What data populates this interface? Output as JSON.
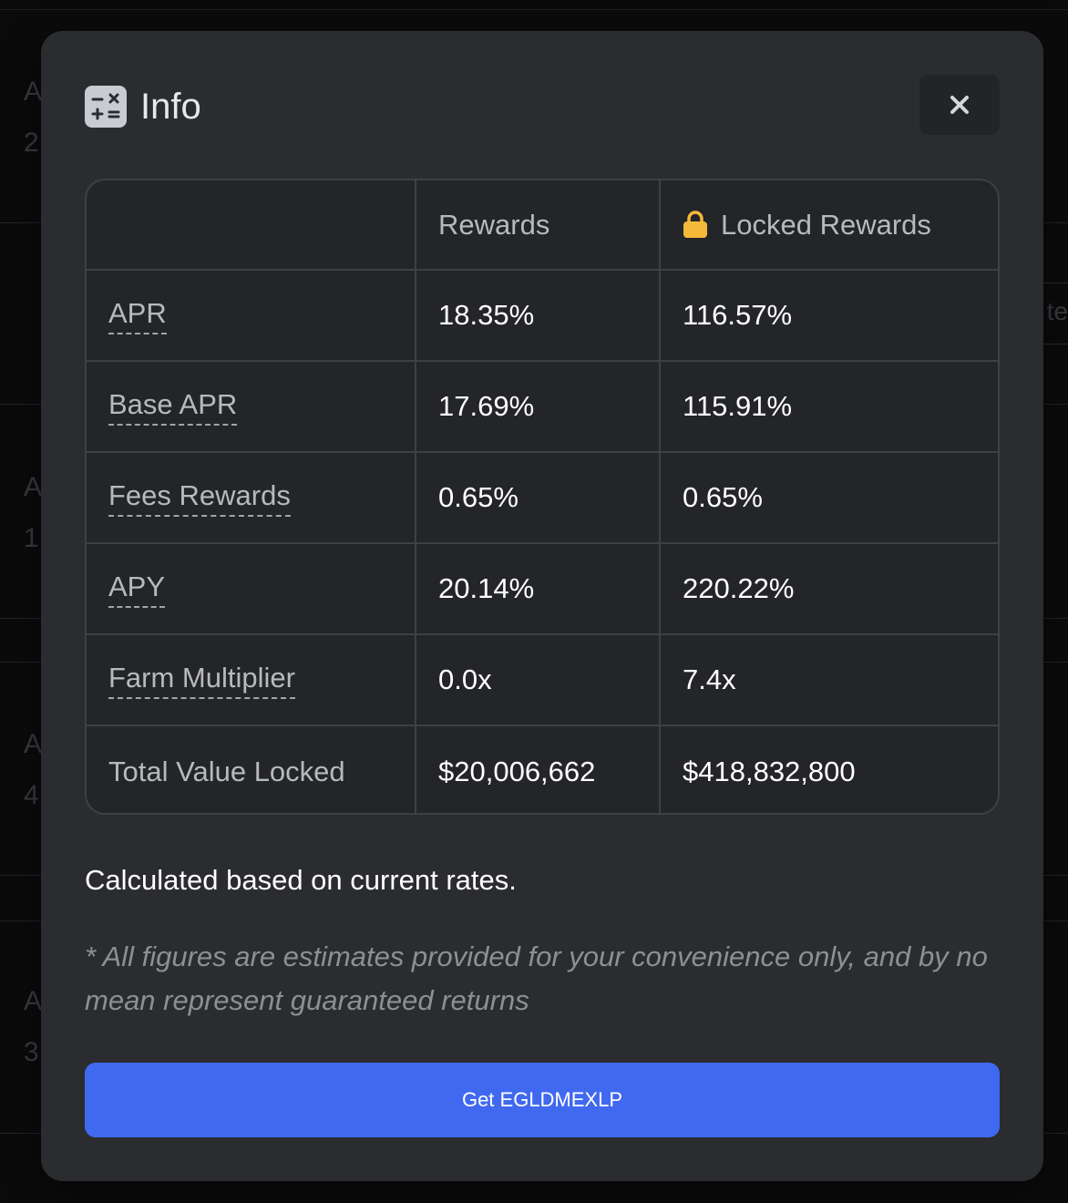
{
  "background": {
    "left_fragments": [
      "A",
      "2",
      "A",
      "1",
      "A",
      "4",
      "A",
      "3"
    ],
    "right_fragment": "te"
  },
  "modal": {
    "title": "Info",
    "title_icon": "calculator-icon",
    "close_icon": "close-icon",
    "table": {
      "headers": [
        "",
        "Rewards",
        "Locked Rewards"
      ],
      "locked_header_icon": "lock-icon",
      "rows": [
        {
          "label": "APR",
          "rewards": "18.35%",
          "locked": "116.57%",
          "dotted": true
        },
        {
          "label": "Base APR",
          "rewards": "17.69%",
          "locked": "115.91%",
          "dotted": true
        },
        {
          "label": "Fees Rewards",
          "rewards": "0.65%",
          "locked": "0.65%",
          "dotted": true
        },
        {
          "label": "APY",
          "rewards": "20.14%",
          "locked": "220.22%",
          "dotted": true
        },
        {
          "label": "Farm Multiplier",
          "rewards": "0.0x",
          "locked": "7.4x",
          "dotted": true
        },
        {
          "label": "Total Value Locked",
          "rewards": "$20,006,662",
          "locked": "$418,832,800",
          "dotted": false
        }
      ]
    },
    "calc_note": "Calculated based on current rates.",
    "disclaimer": "* All figures are estimates provided for your convenience only, and by no mean represent guaranteed returns",
    "cta_label": "Get EGLDMEXLP"
  },
  "colors": {
    "accent": "#4169f0",
    "lock": "#f5b93a",
    "modal_bg": "#2b2c2f"
  }
}
